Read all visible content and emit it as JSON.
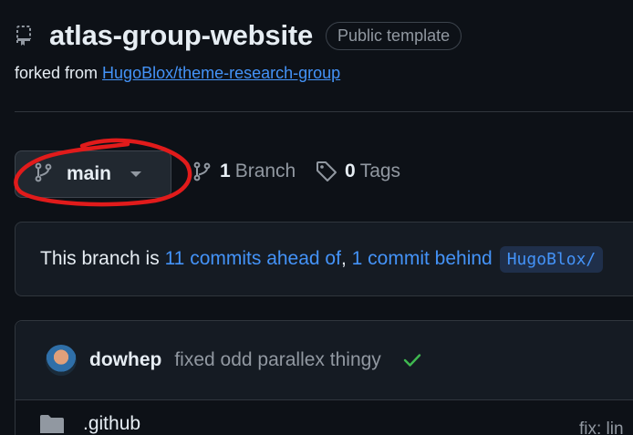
{
  "repo": {
    "name": "atlas-group-website",
    "badge": "Public template",
    "forked_prefix": "forked from",
    "forked_link": "HugoBlox/theme-research-group"
  },
  "branch": {
    "current": "main",
    "branch_count": "1",
    "branch_label": "Branch",
    "tag_count": "0",
    "tag_label": "Tags"
  },
  "ahead_behind": {
    "prefix": "This branch is",
    "ahead": "11 commits ahead of",
    "comma": ",",
    "behind": "1 commit behind",
    "upstream": "HugoBlox/"
  },
  "commit": {
    "author": "dowhep",
    "message": "fixed odd parallex thingy"
  },
  "files": [
    {
      "name": ".github",
      "message": "fix: lin"
    }
  ],
  "colors": {
    "accent": "#4493f8",
    "success": "#3fb950",
    "annotation": "#e11b1b"
  }
}
